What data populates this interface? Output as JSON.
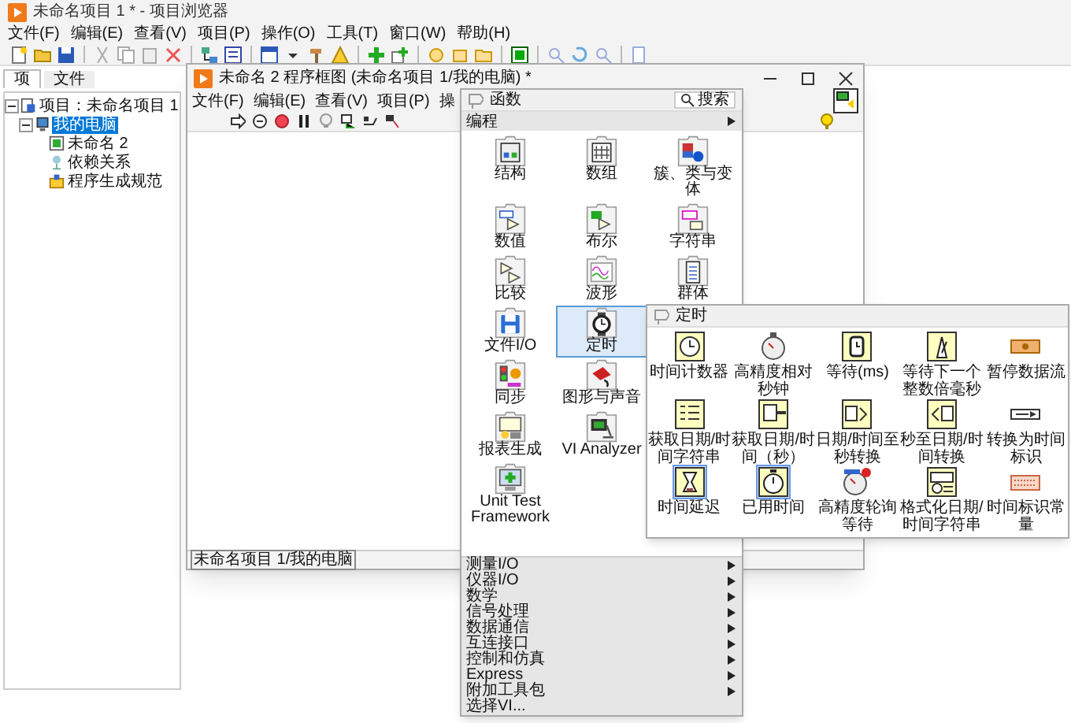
{
  "project_window": {
    "title": "未命名项目 1 * - 项目浏览器",
    "menu": [
      "文件(F)",
      "编辑(E)",
      "查看(V)",
      "项目(P)",
      "操作(O)",
      "工具(T)",
      "窗口(W)",
      "帮助(H)"
    ],
    "tabs": [
      {
        "label": "项",
        "selected": true
      },
      {
        "label": "文件",
        "selected": false
      }
    ],
    "tree": [
      {
        "label": "项目：未命名项目 1",
        "kind": "project",
        "expanded": true,
        "selected": false,
        "children": [
          {
            "label": "我的电脑",
            "kind": "computer",
            "expanded": true,
            "selected": true,
            "children": [
              {
                "label": "未命名 2",
                "kind": "vi",
                "selected": false
              },
              {
                "label": "依赖关系",
                "kind": "dependencies",
                "selected": false
              },
              {
                "label": "程序生成规范",
                "kind": "build",
                "selected": false
              }
            ]
          }
        ]
      }
    ]
  },
  "diagram_window": {
    "title": "未命名 2 程序框图 (未命名项目 1/我的电脑) *",
    "menu": [
      "文件(F)",
      "编辑(E)",
      "查看(V)",
      "项目(P)",
      "操"
    ],
    "status": "未命名项目 1/我的电脑"
  },
  "functions_palette": {
    "title": "函数",
    "search": "搜索",
    "category": "编程",
    "rows": [
      {
        "items": [
          {
            "label": "结构",
            "kind": "structure",
            "selected": false
          },
          {
            "label": "数组",
            "kind": "array",
            "selected": false
          },
          {
            "label": "簇、类与变体",
            "kind": "cluster",
            "selected": false
          }
        ]
      },
      {
        "items": [
          {
            "label": "数值",
            "kind": "numeric",
            "selected": false
          },
          {
            "label": "布尔",
            "kind": "boolean",
            "selected": false
          },
          {
            "label": "字符串",
            "kind": "string",
            "selected": false
          }
        ]
      },
      {
        "items": [
          {
            "label": "比较",
            "kind": "comparison",
            "selected": false
          },
          {
            "label": "波形",
            "kind": "waveform",
            "selected": false
          },
          {
            "label": "群体",
            "kind": "collection",
            "selected": false
          }
        ]
      },
      {
        "items": [
          {
            "label": "文件I/O",
            "kind": "file",
            "selected": false
          },
          {
            "label": "定时",
            "kind": "timing",
            "selected": true
          }
        ]
      },
      {
        "items": [
          {
            "label": "同步",
            "kind": "sync",
            "selected": false
          },
          {
            "label": "图形与声音",
            "kind": "graphics",
            "selected": false
          }
        ]
      },
      {
        "items": [
          {
            "label": "报表生成",
            "kind": "report",
            "selected": false
          },
          {
            "label": "VI Analyzer",
            "kind": "analyzer",
            "selected": false
          }
        ]
      },
      {
        "items": [
          {
            "label": "Unit Test Framework",
            "kind": "unittest",
            "selected": false
          }
        ]
      }
    ],
    "categories": [
      {
        "label": "测量I/O",
        "submenu": true
      },
      {
        "label": "仪器I/O",
        "submenu": true
      },
      {
        "label": "数学",
        "submenu": true
      },
      {
        "label": "信号处理",
        "submenu": true
      },
      {
        "label": "数据通信",
        "submenu": true
      },
      {
        "label": "互连接口",
        "submenu": true
      },
      {
        "label": "控制和仿真",
        "submenu": true
      },
      {
        "label": "Express",
        "submenu": true
      },
      {
        "label": "附加工具包",
        "submenu": true
      },
      {
        "label": "选择VI...",
        "submenu": false
      }
    ]
  },
  "timing_palette": {
    "title": "定时",
    "items": [
      {
        "label": "时间计数器",
        "kind": "tick",
        "selected": false
      },
      {
        "label": "高精度相对秒钟",
        "kind": "hires_seconds",
        "selected": false
      },
      {
        "label": "等待(ms)",
        "kind": "wait",
        "selected": false
      },
      {
        "label": "等待下一个整数倍毫秒",
        "kind": "wait_multiple",
        "selected": false
      },
      {
        "label": "暂停数据流",
        "kind": "pause",
        "selected": false
      },
      {
        "label": "获取日期/时间字符串",
        "kind": "date_string",
        "selected": false
      },
      {
        "label": "获取日期/时间（秒）",
        "kind": "date_seconds",
        "selected": false
      },
      {
        "label": "日期/时间至秒转换",
        "kind": "date_to_seconds",
        "selected": false
      },
      {
        "label": "秒至日期/时间转换",
        "kind": "seconds_to_date",
        "selected": false
      },
      {
        "label": "转换为时间标识",
        "kind": "to_timestamp",
        "selected": false
      },
      {
        "label": "时间延迟",
        "kind": "delay",
        "selected": true
      },
      {
        "label": "已用时间",
        "kind": "elapsed",
        "selected": true
      },
      {
        "label": "高精度轮询等待",
        "kind": "polling_wait",
        "selected": false
      },
      {
        "label": "格式化日期/时间字符串",
        "kind": "format_date",
        "selected": false
      },
      {
        "label": "时间标识常量",
        "kind": "timestamp_constant",
        "selected": false
      }
    ]
  }
}
